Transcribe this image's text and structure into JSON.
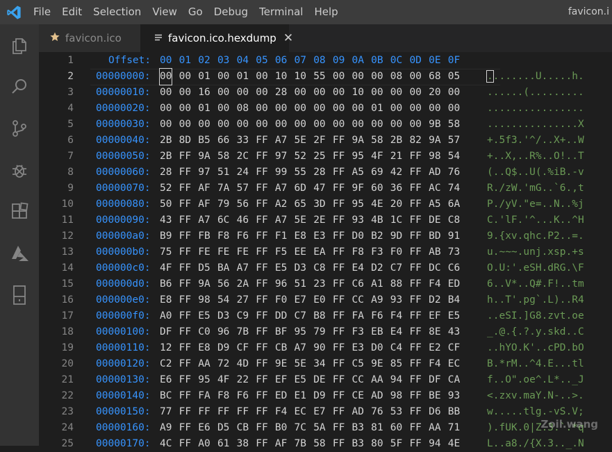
{
  "menu": [
    "File",
    "Edit",
    "Selection",
    "View",
    "Go",
    "Debug",
    "Terminal",
    "Help"
  ],
  "window_title": "favicon.i",
  "activity_icons": [
    "explorer-icon",
    "search-icon",
    "source-control-icon",
    "debug-icon",
    "extensions-icon",
    "azure-icon",
    "device-icon"
  ],
  "tabs": [
    {
      "label": "favicon.ico",
      "icon": "star-icon",
      "active": false
    },
    {
      "label": "favicon.ico.hexdump",
      "icon": "lines-icon",
      "active": true
    }
  ],
  "header": {
    "label": "Offset:",
    "columns": [
      "00",
      "01",
      "02",
      "03",
      "04",
      "05",
      "06",
      "07",
      "08",
      "09",
      "0A",
      "0B",
      "0C",
      "0D",
      "0E",
      "0F"
    ]
  },
  "line_numbers": [
    "1",
    "2",
    "3",
    "4",
    "5",
    "6",
    "7",
    "8",
    "9",
    "10",
    "11",
    "12",
    "13",
    "14",
    "15",
    "16",
    "17",
    "18",
    "19",
    "20",
    "21",
    "22",
    "23",
    "24",
    "25"
  ],
  "rows": [
    {
      "offset": "00000000:",
      "bytes": [
        "00",
        "00",
        "01",
        "00",
        "01",
        "00",
        "10",
        "10",
        "55",
        "00",
        "00",
        "00",
        "08",
        "00",
        "68",
        "05"
      ],
      "ascii": "........U.....h."
    },
    {
      "offset": "00000010:",
      "bytes": [
        "00",
        "00",
        "16",
        "00",
        "00",
        "00",
        "28",
        "00",
        "00",
        "00",
        "10",
        "00",
        "00",
        "00",
        "20",
        "00"
      ],
      "ascii": "......(........."
    },
    {
      "offset": "00000020:",
      "bytes": [
        "00",
        "00",
        "01",
        "00",
        "08",
        "00",
        "00",
        "00",
        "00",
        "00",
        "00",
        "01",
        "00",
        "00",
        "00",
        "00"
      ],
      "ascii": "................"
    },
    {
      "offset": "00000030:",
      "bytes": [
        "00",
        "00",
        "00",
        "00",
        "00",
        "00",
        "00",
        "00",
        "00",
        "00",
        "00",
        "00",
        "00",
        "00",
        "9B",
        "58"
      ],
      "ascii": "...............X"
    },
    {
      "offset": "00000040:",
      "bytes": [
        "2B",
        "8D",
        "B5",
        "66",
        "33",
        "FF",
        "A7",
        "5E",
        "2F",
        "FF",
        "9A",
        "58",
        "2B",
        "82",
        "9A",
        "57"
      ],
      "ascii": "+.5f3.'^/..X+..W"
    },
    {
      "offset": "00000050:",
      "bytes": [
        "2B",
        "FF",
        "9A",
        "58",
        "2C",
        "FF",
        "97",
        "52",
        "25",
        "FF",
        "95",
        "4F",
        "21",
        "FF",
        "98",
        "54"
      ],
      "ascii": "+..X,..R%..O!..T"
    },
    {
      "offset": "00000060:",
      "bytes": [
        "28",
        "FF",
        "97",
        "51",
        "24",
        "FF",
        "99",
        "55",
        "28",
        "FF",
        "A5",
        "69",
        "42",
        "FF",
        "AD",
        "76"
      ],
      "ascii": "(..Q$..U(.%iB.-v"
    },
    {
      "offset": "00000070:",
      "bytes": [
        "52",
        "FF",
        "AF",
        "7A",
        "57",
        "FF",
        "A7",
        "6D",
        "47",
        "FF",
        "9F",
        "60",
        "36",
        "FF",
        "AC",
        "74"
      ],
      "ascii": "R./zW.'mG..`6.,t"
    },
    {
      "offset": "00000080:",
      "bytes": [
        "50",
        "FF",
        "AF",
        "79",
        "56",
        "FF",
        "A2",
        "65",
        "3D",
        "FF",
        "95",
        "4E",
        "20",
        "FF",
        "A5",
        "6A"
      ],
      "ascii": "P./yV.\"e=..N..%j"
    },
    {
      "offset": "00000090:",
      "bytes": [
        "43",
        "FF",
        "A7",
        "6C",
        "46",
        "FF",
        "A7",
        "5E",
        "2E",
        "FF",
        "93",
        "4B",
        "1C",
        "FF",
        "DE",
        "C8"
      ],
      "ascii": "C.'lF.'^...K..^H"
    },
    {
      "offset": "000000a0:",
      "bytes": [
        "B9",
        "FF",
        "FB",
        "F8",
        "F6",
        "FF",
        "F1",
        "E8",
        "E3",
        "FF",
        "D0",
        "B2",
        "9D",
        "FF",
        "BD",
        "91"
      ],
      "ascii": "9.{xv.qhc.P2..=."
    },
    {
      "offset": "000000b0:",
      "bytes": [
        "75",
        "FF",
        "FE",
        "FE",
        "FE",
        "FF",
        "F5",
        "EE",
        "EA",
        "FF",
        "F8",
        "F3",
        "F0",
        "FF",
        "AB",
        "73"
      ],
      "ascii": "u.~~~.unj.xsp.+s"
    },
    {
      "offset": "000000c0:",
      "bytes": [
        "4F",
        "FF",
        "D5",
        "BA",
        "A7",
        "FF",
        "E5",
        "D3",
        "C8",
        "FF",
        "E4",
        "D2",
        "C7",
        "FF",
        "DC",
        "C6"
      ],
      "ascii": "O.U:'.eSH.dRG.\\F"
    },
    {
      "offset": "000000d0:",
      "bytes": [
        "B6",
        "FF",
        "9A",
        "56",
        "2A",
        "FF",
        "96",
        "51",
        "23",
        "FF",
        "C6",
        "A1",
        "88",
        "FF",
        "F4",
        "ED"
      ],
      "ascii": "6..V*..Q#.F!..tm"
    },
    {
      "offset": "000000e0:",
      "bytes": [
        "E8",
        "FF",
        "98",
        "54",
        "27",
        "FF",
        "F0",
        "E7",
        "E0",
        "FF",
        "CC",
        "A9",
        "93",
        "FF",
        "D2",
        "B4"
      ],
      "ascii": "h..T'.pg`.L)..R4"
    },
    {
      "offset": "000000f0:",
      "bytes": [
        "A0",
        "FF",
        "E5",
        "D3",
        "C9",
        "FF",
        "DD",
        "C7",
        "B8",
        "FF",
        "FA",
        "F6",
        "F4",
        "FF",
        "EF",
        "E5"
      ],
      "ascii": "..eSI.]G8.zvt.oe"
    },
    {
      "offset": "00000100:",
      "bytes": [
        "DF",
        "FF",
        "C0",
        "96",
        "7B",
        "FF",
        "BF",
        "95",
        "79",
        "FF",
        "F3",
        "EB",
        "E4",
        "FF",
        "8E",
        "43"
      ],
      "ascii": "_.@.{.?.y.skd..C"
    },
    {
      "offset": "00000110:",
      "bytes": [
        "12",
        "FF",
        "E8",
        "D9",
        "CF",
        "FF",
        "CB",
        "A7",
        "90",
        "FF",
        "E3",
        "D0",
        "C4",
        "FF",
        "E2",
        "CF"
      ],
      "ascii": "..hYO.K'..cPD.bO"
    },
    {
      "offset": "00000120:",
      "bytes": [
        "C2",
        "FF",
        "AA",
        "72",
        "4D",
        "FF",
        "9E",
        "5E",
        "34",
        "FF",
        "C5",
        "9E",
        "85",
        "FF",
        "F4",
        "EC"
      ],
      "ascii": "B.*rM..^4.E...tl"
    },
    {
      "offset": "00000130:",
      "bytes": [
        "E6",
        "FF",
        "95",
        "4F",
        "22",
        "FF",
        "EF",
        "E5",
        "DE",
        "FF",
        "CC",
        "AA",
        "94",
        "FF",
        "DF",
        "CA"
      ],
      "ascii": "f..O\".oe^.L*.._J"
    },
    {
      "offset": "00000140:",
      "bytes": [
        "BC",
        "FF",
        "FA",
        "F8",
        "F6",
        "FF",
        "ED",
        "E1",
        "D9",
        "FF",
        "CE",
        "AD",
        "98",
        "FF",
        "BE",
        "93"
      ],
      "ascii": "<.zxv.maY.N-..>."
    },
    {
      "offset": "00000150:",
      "bytes": [
        "77",
        "FF",
        "FF",
        "FF",
        "FF",
        "FF",
        "F4",
        "EC",
        "E7",
        "FF",
        "AD",
        "76",
        "53",
        "FF",
        "D6",
        "BB"
      ],
      "ascii": "w.....tlg.-vS.V;"
    },
    {
      "offset": "00000160:",
      "bytes": [
        "A9",
        "FF",
        "E6",
        "D5",
        "CB",
        "FF",
        "B0",
        "7C",
        "5A",
        "FF",
        "B3",
        "81",
        "60",
        "FF",
        "AA",
        "71"
      ],
      "ascii": ").fUK.0|Z.3.`.*q"
    },
    {
      "offset": "00000170:",
      "bytes": [
        "4C",
        "FF",
        "A0",
        "61",
        "38",
        "FF",
        "AF",
        "7B",
        "58",
        "FF",
        "B3",
        "80",
        "5F",
        "FF",
        "94",
        "4E"
      ],
      "ascii": "L..a8./{X.3.._.N"
    }
  ],
  "watermark": "Zoil.wang"
}
